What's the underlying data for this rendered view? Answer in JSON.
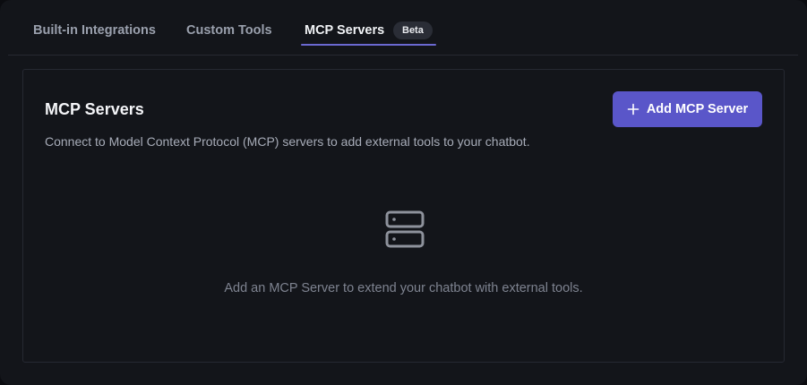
{
  "tabs": [
    {
      "label": "Built-in Integrations",
      "active": false
    },
    {
      "label": "Custom Tools",
      "active": false
    },
    {
      "label": "MCP Servers",
      "active": true,
      "badge": "Beta"
    }
  ],
  "panel": {
    "title": "MCP Servers",
    "description": "Connect to Model Context Protocol (MCP) servers to add external tools to your chatbot.",
    "add_button_label": "Add MCP Server",
    "add_button_icon": "plus-icon",
    "empty_state_icon": "server-icon",
    "empty_state_text": "Add an MCP Server to extend your chatbot with external tools."
  },
  "colors": {
    "background": "#13151a",
    "accent": "#5a56c9",
    "active_tab_underline": "#6b69d1",
    "border": "#262932"
  }
}
